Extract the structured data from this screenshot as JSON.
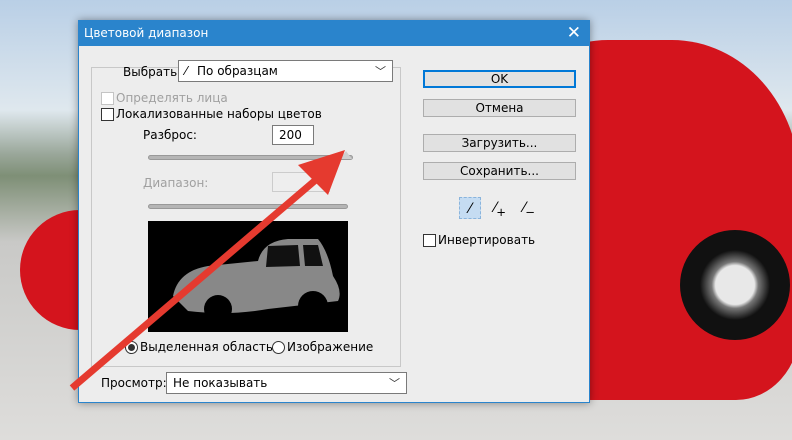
{
  "dialog": {
    "title": "Цветовой диапазон"
  },
  "select": {
    "label": "Выбрать:",
    "value": "По образцам"
  },
  "detect_faces": {
    "label": "Определять лица",
    "checked": false,
    "enabled": false
  },
  "localized": {
    "label": "Локализованные наборы цветов",
    "checked": false
  },
  "fuzziness": {
    "label": "Разброс:",
    "value": "200",
    "slider_fraction": 1.0
  },
  "range": {
    "label": "Диапазон:",
    "value": "",
    "enabled": false
  },
  "radios": {
    "selection": "Выделенная область",
    "image": "Изображение",
    "selected": "selection"
  },
  "preview": {
    "label": "Просмотр:",
    "value": "Не показывать"
  },
  "buttons": {
    "ok": "OK",
    "cancel": "Отмена",
    "load": "Загрузить...",
    "save": "Сохранить..."
  },
  "eyedroppers": [
    "eyedropper-icon",
    "eyedropper-plus-icon",
    "eyedropper-minus-icon"
  ],
  "invert": {
    "label": "Инвертировать",
    "checked": false
  },
  "colors": {
    "title_bar": "#2a84cc",
    "arrow": "#e53a2f",
    "car": "#d4141d"
  }
}
